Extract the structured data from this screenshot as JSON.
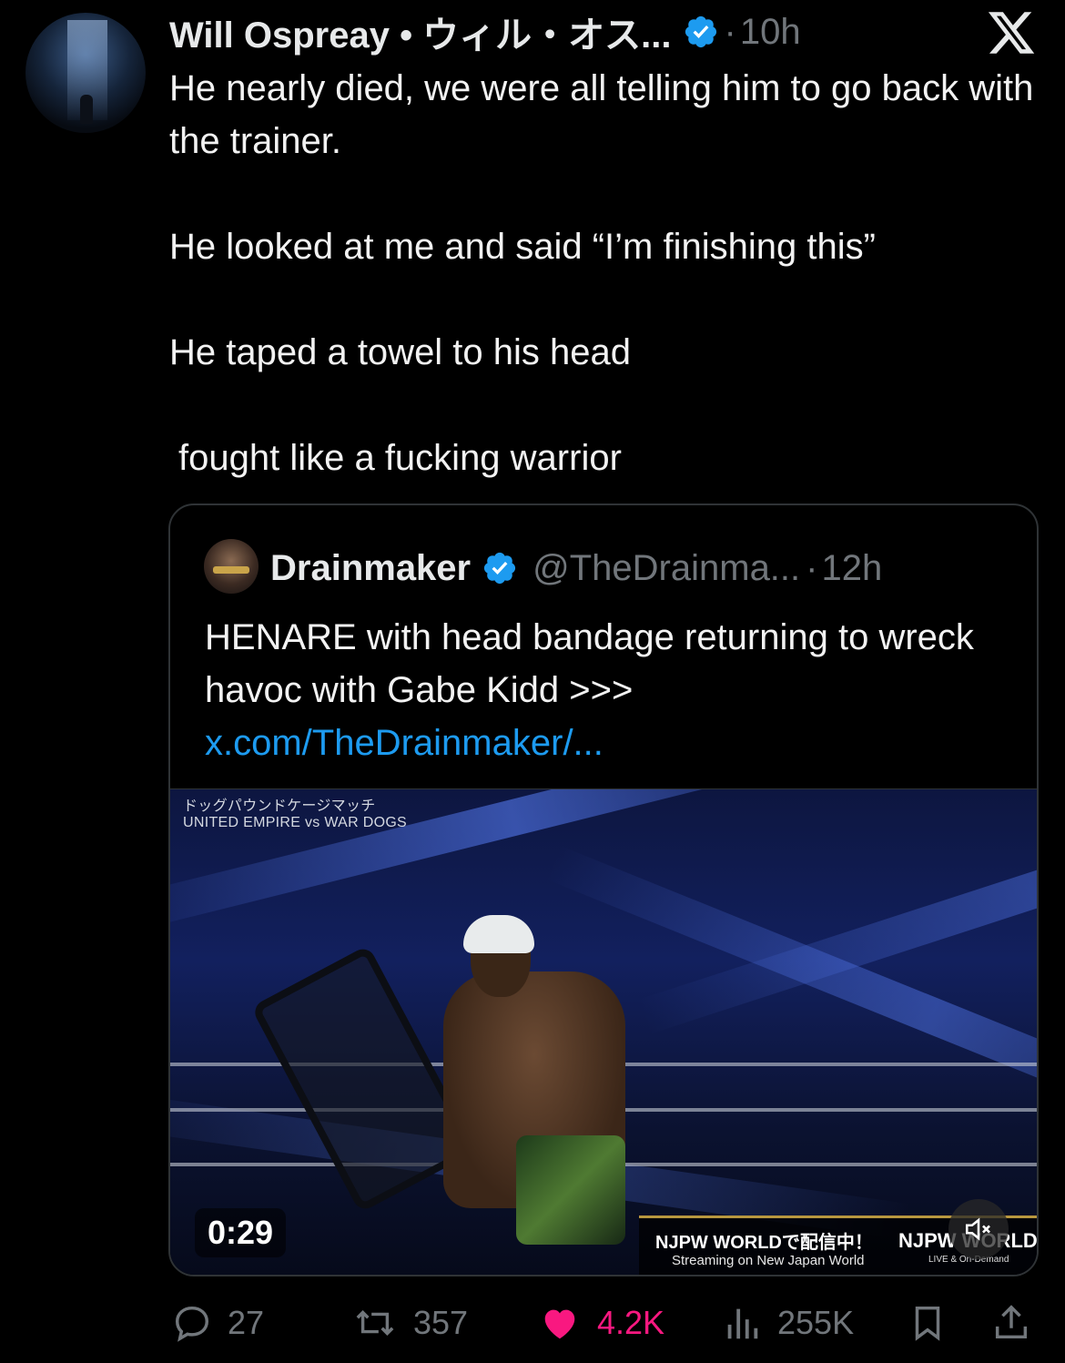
{
  "tweet": {
    "author_name": "Will Ospreay • ウィル・オス...",
    "separator": "·",
    "time": "10h",
    "paragraphs": [
      "He nearly died, we were all telling him to go back with the trainer.",
      "He looked at me and said “I’m finishing this”",
      "He taped a towel to his head",
      "fought like a fucking warrior"
    ]
  },
  "quote": {
    "author_name": "Drainmaker",
    "handle": "@TheDrainma...",
    "separator": "·",
    "time": "12h",
    "text": "HENARE with head bandage returning to wreck havoc with Gabe Kidd >>> ",
    "link_text": "x.com/TheDrainmaker/...",
    "media": {
      "caption_line1": "ドッグパウンドケージマッチ",
      "caption_line2": "UNITED EMPIRE vs WAR DOGS",
      "duration": "0:29",
      "promo_main": "NJPW WORLDで配信中！",
      "promo_sub": "Streaming on New Japan World",
      "logo_text": "NJPW WORLD",
      "logo_tag": "LIVE & On-Demand"
    }
  },
  "actions": {
    "replies": "27",
    "reposts": "357",
    "likes": "4.2K",
    "views": "255K"
  },
  "colors": {
    "background": "#000000",
    "text": "#e7e9ea",
    "muted": "#71767b",
    "link": "#1d9bf0",
    "verified": "#1d9bf0",
    "like": "#f91880"
  },
  "icons": [
    "x-logo-icon",
    "verified-badge-icon",
    "reply-icon",
    "repost-icon",
    "heart-icon",
    "views-icon",
    "bookmark-icon",
    "share-icon",
    "mute-icon"
  ]
}
